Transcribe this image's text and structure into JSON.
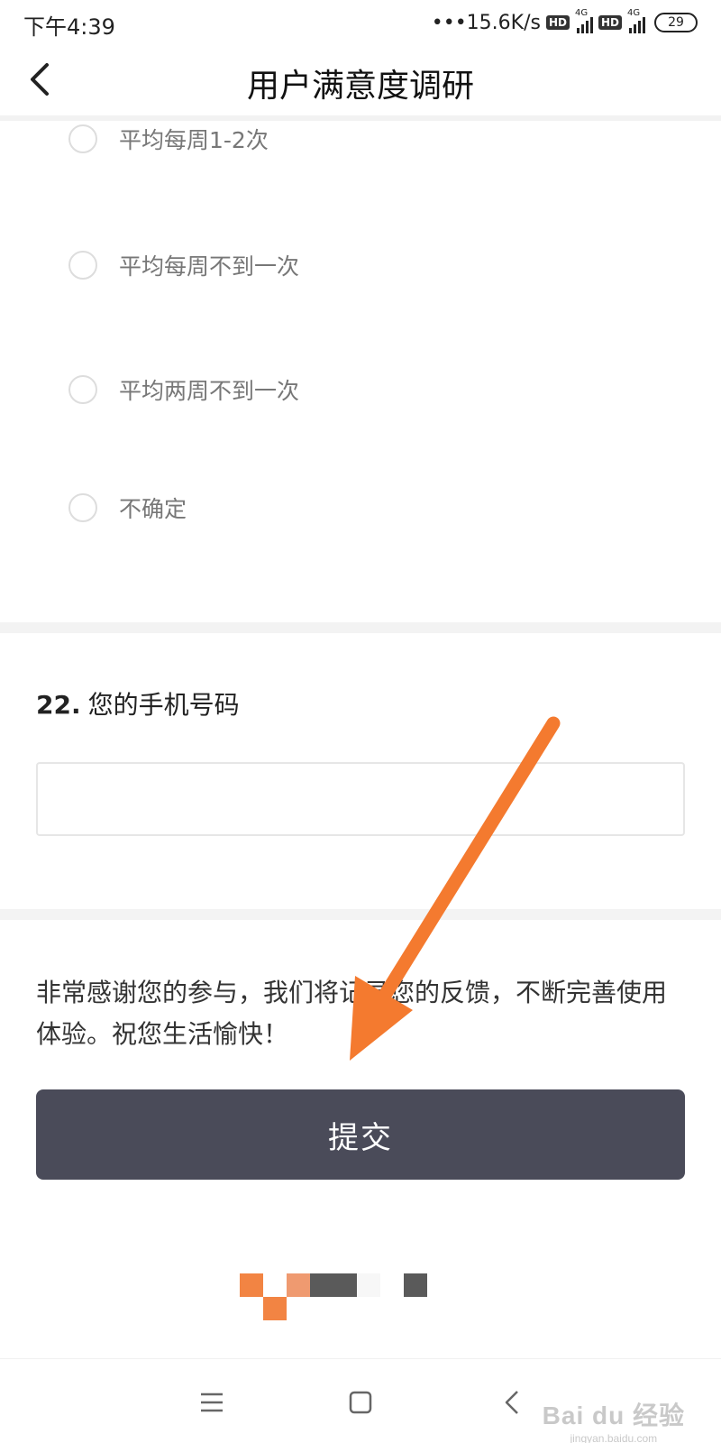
{
  "status_bar": {
    "time": "下午4:39",
    "dots": "•••",
    "net_speed": "15.6K/s",
    "hd": "HD",
    "network": "4G",
    "battery": "29"
  },
  "header": {
    "title": "用户满意度调研"
  },
  "options": [
    "平均每周1-2次",
    "平均每周不到一次",
    "平均两周不到一次",
    "不确定"
  ],
  "question": {
    "number": "22.",
    "text": "您的手机号码",
    "input_value": ""
  },
  "thanks_text": "非常感谢您的参与，我们将记录您的反馈，不断完善使用体验。祝您生活愉快！",
  "submit_label": "提交",
  "watermark": {
    "brand": "Bai du 经验",
    "url": "jingyan.baidu.com"
  },
  "colors": {
    "submit_bg": "#4a4b59",
    "arrow": "#f47a2f"
  }
}
